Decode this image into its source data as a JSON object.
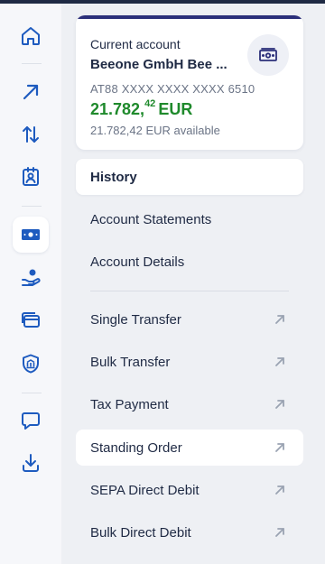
{
  "rail": {
    "items": [
      {
        "name": "home",
        "icon": "home-icon"
      },
      {
        "name": "send",
        "icon": "arrow-up-right-icon"
      },
      {
        "name": "transfers",
        "icon": "arrows-up-down-icon"
      },
      {
        "name": "contacts",
        "icon": "contact-card-icon"
      },
      {
        "name": "accounts",
        "icon": "cash-icon",
        "active": true
      },
      {
        "name": "loans",
        "icon": "hand-coin-icon"
      },
      {
        "name": "cards",
        "icon": "card-icon"
      },
      {
        "name": "security",
        "icon": "bank-shield-icon"
      },
      {
        "name": "messages",
        "icon": "chat-bubble-icon"
      },
      {
        "name": "downloads",
        "icon": "download-icon"
      }
    ]
  },
  "account": {
    "type": "Current account",
    "name": "Beeone GmbH Bee ...",
    "iban": "AT88 XXXX XXXX XXXX 6510",
    "amount_main": "21.782,",
    "amount_cents": "42",
    "currency": "EUR",
    "available": "21.782,42 EUR available",
    "icon": "cash-icon"
  },
  "menu": {
    "items": [
      {
        "label": "History",
        "active": true
      },
      {
        "label": "Account Statements"
      },
      {
        "label": "Account Details"
      },
      {
        "label": "Single Transfer",
        "external": true
      },
      {
        "label": "Bulk Transfer",
        "external": true
      },
      {
        "label": "Tax Payment",
        "external": true
      },
      {
        "label": "Standing Order",
        "external": true,
        "highlighted": true
      },
      {
        "label": "SEPA Direct Debit",
        "external": true
      },
      {
        "label": "Bulk Direct Debit",
        "external": true
      }
    ]
  },
  "colors": {
    "brand": "#1e5bbf",
    "accent_bar": "#2b2f7a",
    "positive": "#1f8a2c",
    "text": "#1f2a44",
    "muted": "#6b7486"
  }
}
